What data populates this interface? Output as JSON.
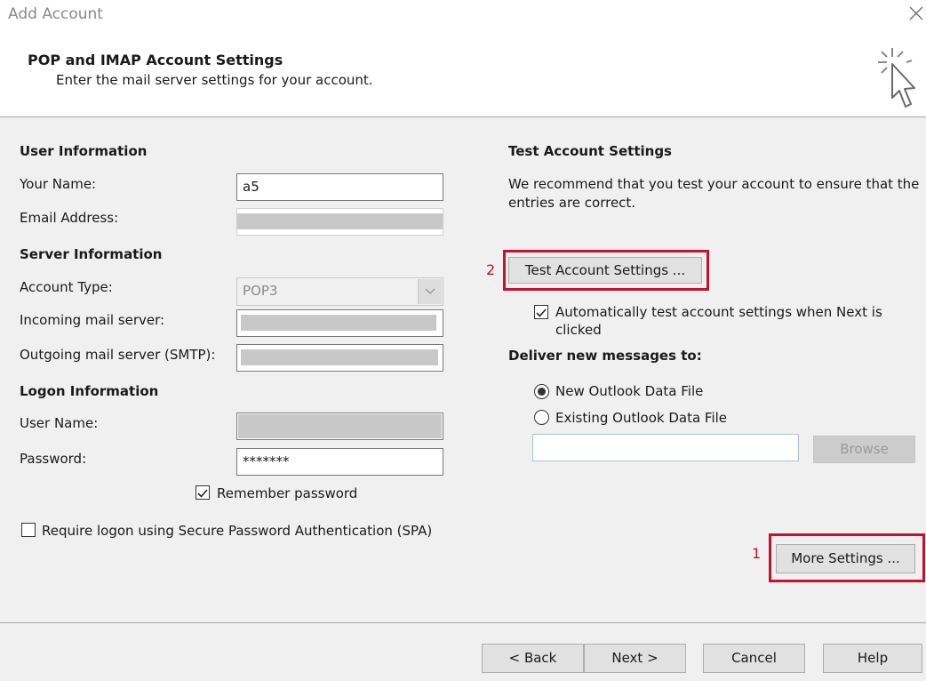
{
  "window": {
    "title": "Add Account"
  },
  "header": {
    "title": "POP and IMAP Account Settings",
    "subtitle": "Enter the mail server settings for your account."
  },
  "user_info": {
    "heading": "User Information",
    "your_name_label": "Your Name:",
    "your_name_value": "a5",
    "email_label": "Email Address:"
  },
  "server_info": {
    "heading": "Server Information",
    "account_type_label": "Account Type:",
    "account_type_value": "POP3",
    "incoming_label": "Incoming mail server:",
    "outgoing_label": "Outgoing mail server (SMTP):"
  },
  "logon_info": {
    "heading": "Logon Information",
    "username_label": "User Name:",
    "password_label": "Password:",
    "password_value": "*******",
    "remember_label": "Remember password",
    "remember_checked": true,
    "spa_label": "Require logon using Secure Password Authentication (SPA)",
    "spa_checked": false
  },
  "test_settings": {
    "heading": "Test Account Settings",
    "description": "We recommend that you test your account to ensure that the entries are correct.",
    "button_label": "Test Account Settings ...",
    "callout": "2",
    "auto_test_label": "Automatically test account settings when Next is clicked",
    "auto_test_checked": true
  },
  "deliver": {
    "heading": "Deliver new messages to:",
    "option_new": "New Outlook Data File",
    "option_existing": "Existing Outlook Data File",
    "selected": "new",
    "browse_label": "Browse"
  },
  "more_settings": {
    "button_label": "More Settings ...",
    "callout": "1"
  },
  "footer": {
    "back_label": "< Back",
    "next_label": "Next >",
    "cancel_label": "Cancel",
    "help_label": "Help"
  },
  "colors": {
    "highlight": "#c8102e",
    "header_bg": "#ffffff",
    "body_bg": "#f0f0f0"
  }
}
